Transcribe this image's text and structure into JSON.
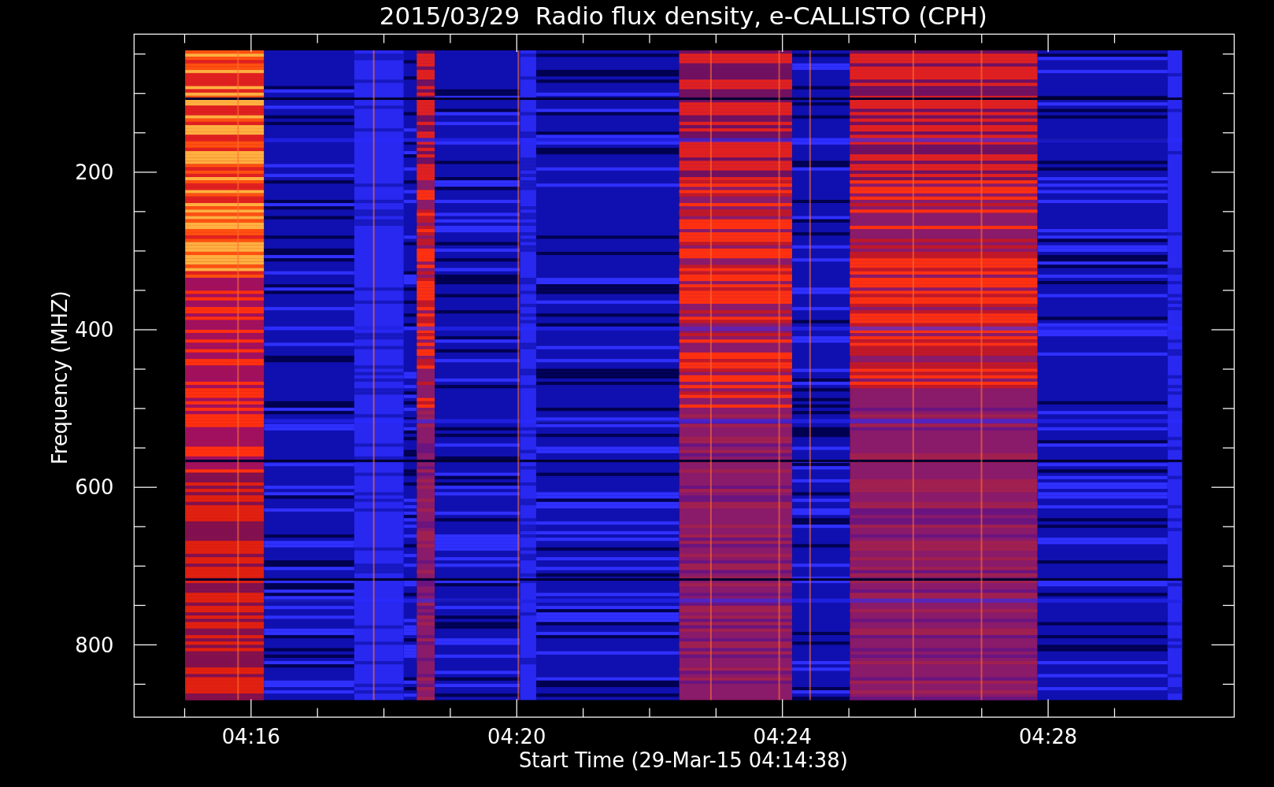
{
  "plot": {
    "title": "2015/03/29  Radio flux density, e-CALLISTO (CPH)",
    "ylabel": "Frequency (MHZ)",
    "xlabel": "Start Time (29-Mar-15 04:14:38)",
    "y_tick_labels": [
      "200",
      "400",
      "600",
      "800"
    ],
    "x_tick_labels": [
      "04:16",
      "04:20",
      "04:24",
      "04:28"
    ]
  }
}
